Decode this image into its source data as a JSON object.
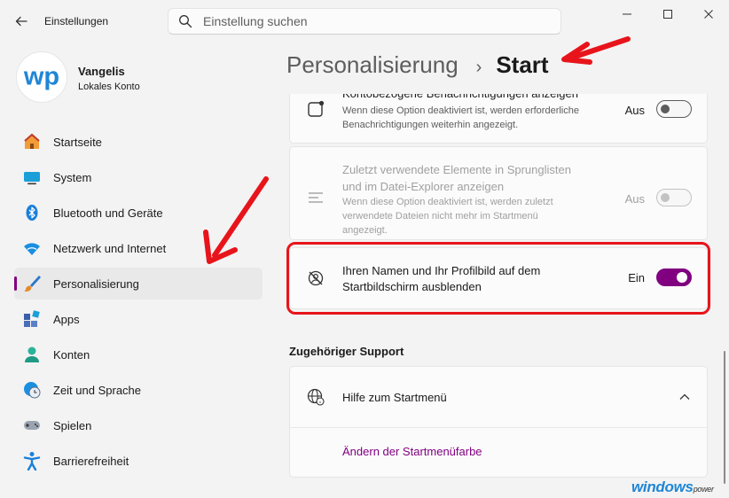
{
  "window": {
    "app_title": "Einstellungen",
    "back_icon": "arrow-left-icon",
    "controls": [
      "minimize-icon",
      "maximize-icon",
      "close-icon"
    ]
  },
  "search": {
    "placeholder": "Einstellung suchen",
    "icon": "search-icon"
  },
  "profile": {
    "avatar_text": "wp",
    "name": "Vangelis",
    "account_type": "Lokales Konto"
  },
  "sidebar": {
    "items": [
      {
        "label": "Startseite",
        "icon": "home-icon",
        "active": false
      },
      {
        "label": "System",
        "icon": "monitor-icon",
        "active": false
      },
      {
        "label": "Bluetooth und Geräte",
        "icon": "bluetooth-icon",
        "active": false
      },
      {
        "label": "Netzwerk und Internet",
        "icon": "wifi-icon",
        "active": false
      },
      {
        "label": "Personalisierung",
        "icon": "brush-icon",
        "active": true
      },
      {
        "label": "Apps",
        "icon": "apps-icon",
        "active": false
      },
      {
        "label": "Konten",
        "icon": "user-icon",
        "active": false
      },
      {
        "label": "Zeit und Sprache",
        "icon": "globe-clock-icon",
        "active": false
      },
      {
        "label": "Spielen",
        "icon": "gamepad-icon",
        "active": false
      },
      {
        "label": "Barrierefreiheit",
        "icon": "accessibility-icon",
        "active": false
      }
    ]
  },
  "breadcrumb": {
    "parent": "Personalisierung",
    "separator": "›",
    "current": "Start"
  },
  "settings": {
    "notifications": {
      "title": "Kontobezogene Benachrichtigungen anzeigen",
      "description_line1": "Wenn diese Option deaktiviert ist, werden erforderliche",
      "description_line2": "Benachrichtigungen weiterhin angezeigt.",
      "state_label": "Aus",
      "on": false
    },
    "recent_items": {
      "title_line1": "Zuletzt verwendete Elemente in Sprunglisten",
      "title_line2": "und im Datei-Explorer anzeigen",
      "description_line1": "Wenn diese Option deaktiviert ist, werden zuletzt",
      "description_line2": "verwendete Dateien nicht mehr im Startmenü",
      "description_line3": "angezeigt.",
      "state_label": "Aus",
      "on": false,
      "disabled": true
    },
    "hide_profile": {
      "title_line1": "Ihren Namen und Ihr Profilbild auf dem",
      "title_line2": "Startbildschirm ausblenden",
      "state_label": "Ein",
      "on": true
    }
  },
  "support": {
    "heading": "Zugehöriger Support",
    "help_title": "Hilfe zum Startmenü",
    "link": "Ändern der Startmenüfarbe"
  },
  "watermark": {
    "text": "windows",
    "suffix": "power"
  },
  "colors": {
    "accent": "#800080",
    "annotation_red": "#e8141b",
    "background": "#f3f3f3",
    "card": "#fbfbfb"
  }
}
